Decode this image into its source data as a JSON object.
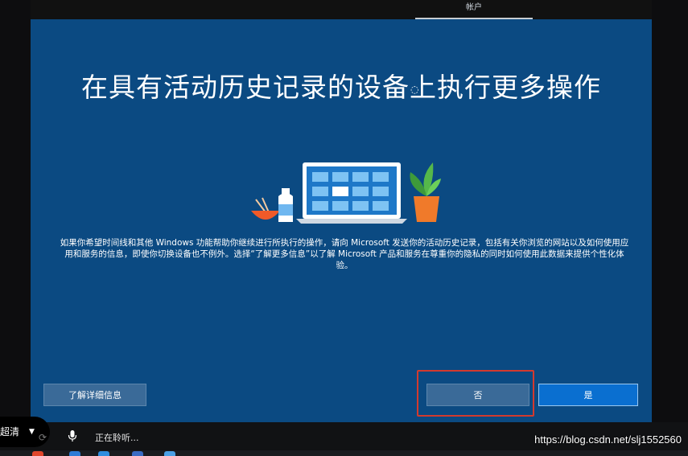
{
  "top_bar": {
    "tab_label": "帐户"
  },
  "headline": "在具有活动历史记录的设备上执行更多操作",
  "body_text": "如果你希望时间线和其他 Windows 功能帮助你继续进行所执行的操作，请向 Microsoft 发送你的活动历史记录，包括有关你浏览的网站以及如何使用应用和服务的信息，即使你切换设备也不例外。选择“了解更多信息”以了解 Microsoft 产品和服务在尊重你的隐私的同时如何使用此数据来提供个性化体验。",
  "buttons": {
    "learn_more": "了解详细信息",
    "no": "否",
    "yes": "是"
  },
  "player": {
    "quality_label": "超清",
    "status_text": "正在聆听..."
  },
  "watermark": "https://blog.csdn.net/slj1552560",
  "colors": {
    "background": "#0b4a82",
    "primary_button": "#0a6fd0",
    "secondary_button": "#3a6a98",
    "highlight_border": "#d33a2e"
  },
  "icons": [
    "laptop-illustration",
    "plant-illustration",
    "bottle-illustration",
    "bowl-illustration",
    "mic-icon",
    "refresh-icon",
    "chevron-down-icon"
  ]
}
